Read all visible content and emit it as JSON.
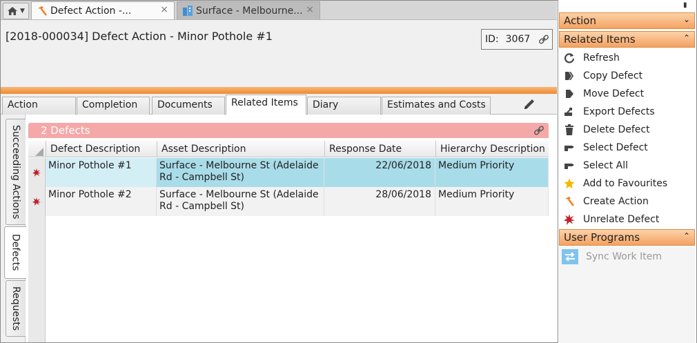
{
  "tabs": [
    {
      "label": "Defect Action -...",
      "close": "×"
    },
    {
      "label": "Surface - Melbourne...",
      "close": "×"
    }
  ],
  "header": {
    "title": "[2018-000034] Defect Action - Minor Pothole #1",
    "id_label": "ID:",
    "id_value": "3067"
  },
  "section_tabs": [
    "Action",
    "Completion",
    "Documents",
    "Related Items",
    "Diary",
    "Estimates and Costs"
  ],
  "vertical_tabs": [
    "Succeeding Actions",
    "Defects",
    "Requests"
  ],
  "grid": {
    "title": "2 Defects",
    "columns": [
      "Defect Description",
      "Asset Description",
      "Response Date",
      "Hierarchy Description"
    ],
    "rows": [
      {
        "defect": "Minor Pothole #1",
        "asset": "Surface - Melbourne St (Adelaide Rd - Campbell St)",
        "date": "22/06/2018",
        "hierarchy": "Medium Priority"
      },
      {
        "defect": "Minor Pothole #2",
        "asset": "Surface - Melbourne St (Adelaide Rd - Campbell St)",
        "date": "28/06/2018",
        "hierarchy": "Medium Priority"
      }
    ]
  },
  "right_panel": {
    "action_header": "Action",
    "related_header": "Related Items",
    "related_items": [
      {
        "label": "Refresh",
        "icon": "refresh-icon"
      },
      {
        "label": "Copy Defect",
        "icon": "copy-icon"
      },
      {
        "label": "Move Defect",
        "icon": "move-icon"
      },
      {
        "label": "Export Defects",
        "icon": "export-icon"
      },
      {
        "label": "Delete Defect",
        "icon": "trash-icon"
      },
      {
        "label": "Select Defect",
        "icon": "pointer-icon"
      },
      {
        "label": "Select All",
        "icon": "pointer-icon"
      },
      {
        "label": "Add to Favourites",
        "icon": "star-icon"
      },
      {
        "label": "Create Action",
        "icon": "hammer-icon"
      },
      {
        "label": "Unrelate Defect",
        "icon": "burst-icon"
      }
    ],
    "user_programs_header": "User Programs",
    "user_programs": [
      {
        "label": "Sync Work Item",
        "icon": "sync-icon"
      }
    ]
  },
  "colors": {
    "accent_orange": "#f18a2e",
    "grid_title_bg": "#f4a8a8",
    "selected_row": "#a9dce9"
  }
}
